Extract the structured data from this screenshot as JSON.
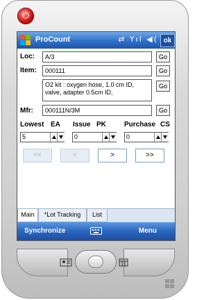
{
  "app": {
    "title": "ProCount",
    "ok_label": "ok",
    "status_icons": "⇄ Yıl ◀("
  },
  "form": {
    "loc": {
      "label": "Loc:",
      "value": "A/3",
      "go": "Go"
    },
    "item": {
      "label": "Item:",
      "value": "000111",
      "go": "Go"
    },
    "description": {
      "value": "O2 kit : oxygen hose, 1.0 cm ID, valve, adapter 0.5cm ID,",
      "go": "Go"
    },
    "mfr": {
      "label": "Mfr:",
      "value": "000111N/3M",
      "go": "Go"
    }
  },
  "units": {
    "lowest": {
      "label": "Lowest",
      "uom": "EA",
      "value": "5"
    },
    "issue": {
      "label": "Issue",
      "uom": "PK",
      "value": "0"
    },
    "purchase": {
      "label": "Purchase",
      "uom": "CS",
      "value": "0"
    }
  },
  "nav": {
    "first": "<<",
    "prev": "<",
    "next": ">",
    "last": ">>"
  },
  "tabs": [
    {
      "label": "Main",
      "active": true
    },
    {
      "label": "*Lot Tracking",
      "active": false
    },
    {
      "label": "List",
      "active": false
    }
  ],
  "menubar": {
    "left": "Synchronize",
    "right": "Menu"
  },
  "colors": {
    "titlebar": "#2f6fc8",
    "menubar": "#2b66c0",
    "power": "#c40000"
  }
}
